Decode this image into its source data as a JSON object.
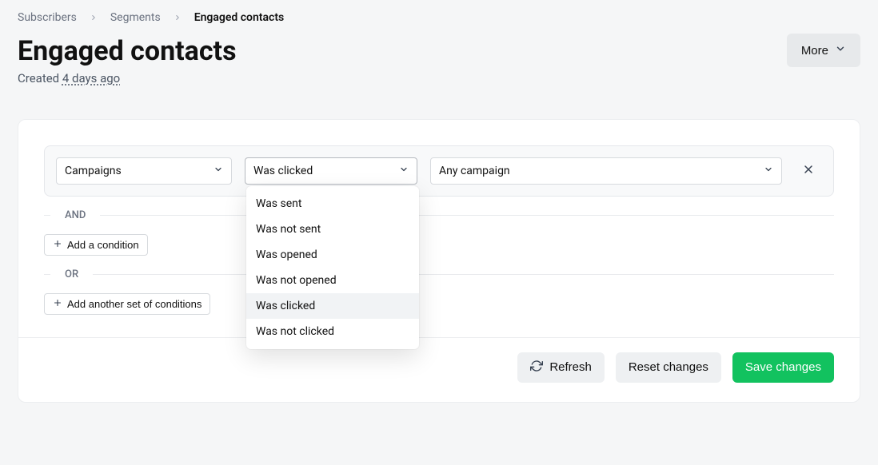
{
  "breadcrumb": {
    "items": [
      "Subscribers",
      "Segments",
      "Engaged contacts"
    ]
  },
  "header": {
    "title": "Engaged contacts",
    "created_prefix": "Created ",
    "created_when": "4 days ago",
    "more_label": "More"
  },
  "condition": {
    "type": "Campaigns",
    "action": "Was clicked",
    "target": "Any campaign"
  },
  "action_options": [
    "Was sent",
    "Was not sent",
    "Was opened",
    "Was not opened",
    "Was clicked",
    "Was not clicked"
  ],
  "operators": {
    "and": "AND",
    "or": "OR"
  },
  "buttons": {
    "add_condition": "Add a condition",
    "add_set": "Add another set of conditions",
    "refresh": "Refresh",
    "reset": "Reset changes",
    "save": "Save changes"
  }
}
